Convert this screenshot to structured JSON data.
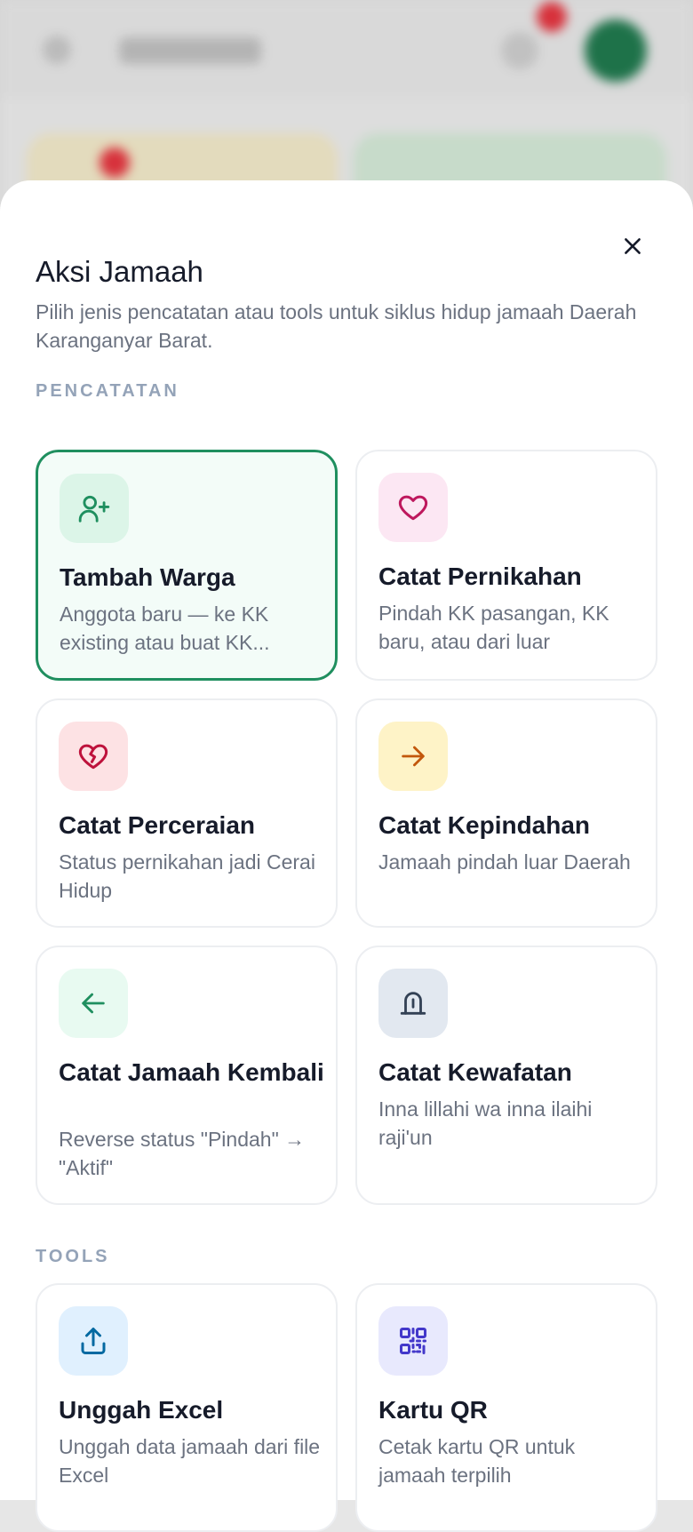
{
  "sheet": {
    "title": "Aksi Jamaah",
    "subtitle": "Pilih jenis pencatatan atau tools untuk siklus hidup jamaah Daerah Karanganyar Barat."
  },
  "sections": {
    "pencatatan": "PENCATATAN",
    "tools": "TOOLS"
  },
  "cards": {
    "tambah_warga": {
      "title": "Tambah Warga",
      "desc": "Anggota baru — ke KK existing atau buat KK...",
      "icon": "user-plus-icon",
      "selected": true
    },
    "catat_pernikahan": {
      "title": "Catat Pernikahan",
      "desc": "Pindah KK pasangan, KK baru, atau dari luar",
      "icon": "heart-icon"
    },
    "catat_perceraian": {
      "title": "Catat Perceraian",
      "desc": "Status pernikahan jadi Cerai Hidup",
      "icon": "broken-heart-icon"
    },
    "catat_kepindahan": {
      "title": "Catat Kepindahan",
      "desc": "Jamaah pindah luar Daerah",
      "icon": "arrow-right-icon"
    },
    "catat_jamaah_kembali": {
      "title": "Catat Jamaah Kembali",
      "desc": "Reverse status \"Pindah\" → \"Aktif\"",
      "icon": "arrow-left-icon"
    },
    "catat_kewafatan": {
      "title": "Catat Kewafatan",
      "desc": "Inna lillahi wa inna ilaihi raji'un",
      "icon": "tombstone-icon"
    },
    "unggah_excel": {
      "title": "Unggah Excel",
      "desc": "Unggah data jamaah dari file Excel",
      "icon": "upload-icon"
    },
    "kartu_qr": {
      "title": "Kartu QR",
      "desc": "Cetak kartu QR untuk jamaah terpilih",
      "icon": "qr-code-icon"
    }
  },
  "colors": {
    "accent_green": "#1f8f5f",
    "green_bg": "#dcf5e8",
    "pink_bg": "#fce7f3",
    "pink": "#be185d",
    "red_bg": "#fde2e4",
    "red": "#be123c",
    "amber_bg": "#fef3c7",
    "amber": "#c2570c",
    "mint_bg": "#e8faf1",
    "slate_bg": "#e2e8f0",
    "slate": "#334155",
    "blue_bg": "#e0f0fe",
    "blue": "#0369a1",
    "indigo_bg": "#e8e9fd",
    "indigo": "#4338ca"
  }
}
